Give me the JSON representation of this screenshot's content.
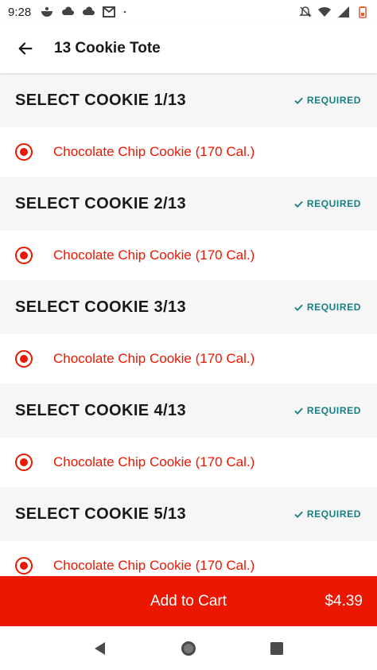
{
  "status_bar": {
    "time": "9:28",
    "left_icons": [
      "bowl-icon",
      "cloud-icon",
      "cloud-icon",
      "gmail-icon",
      "dot-icon"
    ],
    "right_icons": [
      "mute-icon",
      "wifi-icon",
      "signal-icon",
      "battery-icon"
    ]
  },
  "header": {
    "title": "13 Cookie Tote"
  },
  "sections": [
    {
      "title": "SELECT COOKIE 1/13",
      "badge": "REQUIRED",
      "option": "Chocolate Chip Cookie (170 Cal.)",
      "selected": true
    },
    {
      "title": "SELECT COOKIE 2/13",
      "badge": "REQUIRED",
      "option": "Chocolate Chip Cookie (170 Cal.)",
      "selected": true
    },
    {
      "title": "SELECT COOKIE 3/13",
      "badge": "REQUIRED",
      "option": "Chocolate Chip Cookie (170 Cal.)",
      "selected": true
    },
    {
      "title": "SELECT COOKIE 4/13",
      "badge": "REQUIRED",
      "option": "Chocolate Chip Cookie (170 Cal.)",
      "selected": true
    },
    {
      "title": "SELECT COOKIE 5/13",
      "badge": "REQUIRED",
      "option": "Chocolate Chip Cookie (170 Cal.)",
      "selected": true
    }
  ],
  "cart": {
    "label": "Add to Cart",
    "price": "$4.39"
  },
  "colors": {
    "accent": "#eb1700",
    "required": "#157f84",
    "section_bg": "#f6f6f6"
  }
}
